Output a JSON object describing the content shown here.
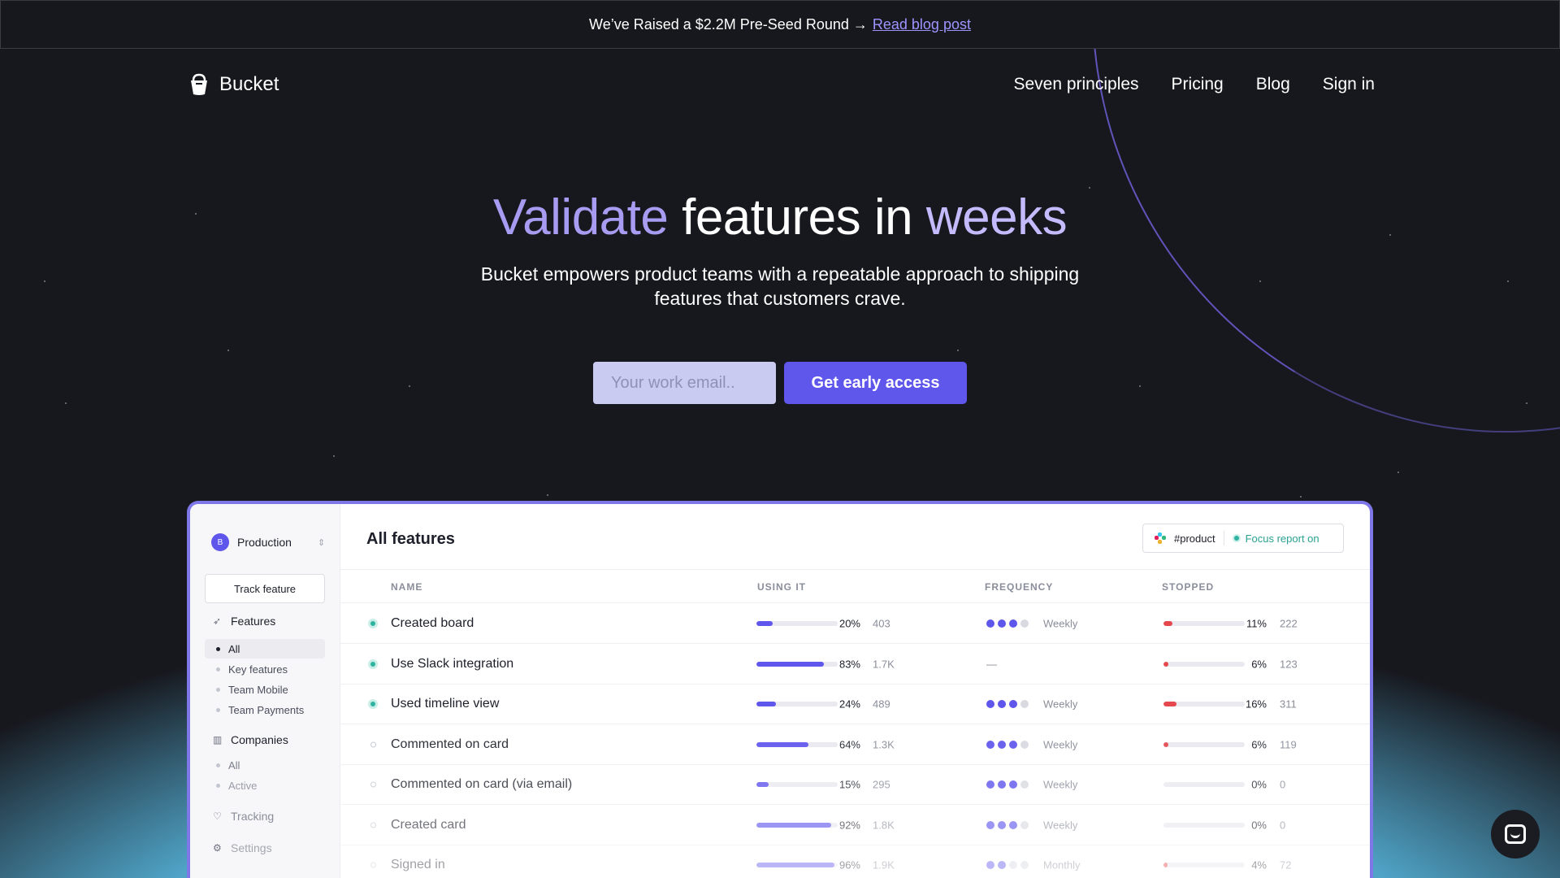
{
  "announcement": {
    "text": "We’ve Raised a $2.2M Pre-Seed Round →",
    "link": "Read blog post"
  },
  "brand": {
    "name": "Bucket",
    "icon": "bucket-icon"
  },
  "nav": {
    "links": [
      "Seven principles",
      "Pricing",
      "Blog",
      "Sign in"
    ]
  },
  "hero": {
    "title_part1": "Validate",
    "title_part2": "features in",
    "title_part3": "weeks",
    "subtitle": "Bucket empowers product teams with a repeatable approach to shipping features that customers crave.",
    "email_placeholder": "Your work email..",
    "cta_label": "Get early access"
  },
  "app": {
    "environment": {
      "avatar": "B",
      "name": "Production"
    },
    "track_button": "Track feature",
    "sidebar": {
      "features_label": "Features",
      "feature_items": [
        "All",
        "Key features",
        "Team Mobile",
        "Team Payments"
      ],
      "companies_label": "Companies",
      "company_items": [
        "All",
        "Active"
      ],
      "tracking_label": "Tracking",
      "settings_label": "Settings"
    },
    "title": "All features",
    "report": {
      "channel": "#product",
      "focus": "Focus report on"
    },
    "columns": [
      "NAME",
      "USING IT",
      "FREQUENCY",
      "STOPPED"
    ],
    "rows": [
      {
        "name": "Created board",
        "active": true,
        "using": 20,
        "using_pct": "20%",
        "using_count": "403",
        "freq_level": 3,
        "freq": "Weekly",
        "stopped": 11,
        "stopped_pct": "11%",
        "stopped_count": "222"
      },
      {
        "name": "Use Slack integration",
        "active": true,
        "using": 83,
        "using_pct": "83%",
        "using_count": "1.7K",
        "freq_level": 0,
        "freq": "—",
        "stopped": 6,
        "stopped_pct": "6%",
        "stopped_count": "123"
      },
      {
        "name": "Used timeline view",
        "active": true,
        "using": 24,
        "using_pct": "24%",
        "using_count": "489",
        "freq_level": 3,
        "freq": "Weekly",
        "stopped": 16,
        "stopped_pct": "16%",
        "stopped_count": "311"
      },
      {
        "name": "Commented on card",
        "active": false,
        "using": 64,
        "using_pct": "64%",
        "using_count": "1.3K",
        "freq_level": 3,
        "freq": "Weekly",
        "stopped": 6,
        "stopped_pct": "6%",
        "stopped_count": "119"
      },
      {
        "name": "Commented on card (via email)",
        "active": false,
        "using": 15,
        "using_pct": "15%",
        "using_count": "295",
        "freq_level": 3,
        "freq": "Weekly",
        "stopped": 0,
        "stopped_pct": "0%",
        "stopped_count": "0"
      },
      {
        "name": "Created card",
        "active": false,
        "using": 92,
        "using_pct": "92%",
        "using_count": "1.8K",
        "freq_level": 3,
        "freq": "Weekly",
        "stopped": 0,
        "stopped_pct": "0%",
        "stopped_count": "0"
      },
      {
        "name": "Signed in",
        "active": false,
        "using": 96,
        "using_pct": "96%",
        "using_count": "1.9K",
        "freq_level": 2,
        "freq": "Monthly",
        "stopped": 4,
        "stopped_pct": "4%",
        "stopped_count": "72"
      }
    ]
  },
  "colors": {
    "accent": "#5f56ec",
    "active_status": "#2fb3a1",
    "stopped": "#e5484d"
  },
  "chat_widget": {
    "icon": "chat-icon"
  }
}
